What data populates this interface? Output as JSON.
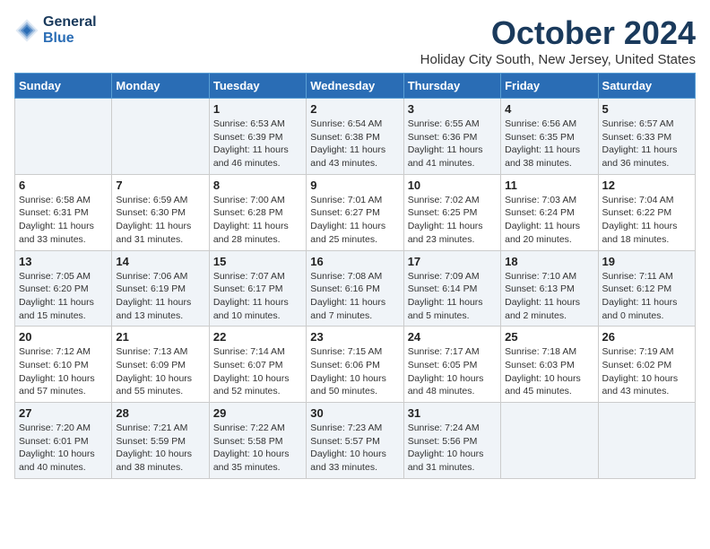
{
  "header": {
    "logo_line1": "General",
    "logo_line2": "Blue",
    "month_title": "October 2024",
    "location": "Holiday City South, New Jersey, United States"
  },
  "weekdays": [
    "Sunday",
    "Monday",
    "Tuesday",
    "Wednesday",
    "Thursday",
    "Friday",
    "Saturday"
  ],
  "weeks": [
    [
      {
        "day": "",
        "info": ""
      },
      {
        "day": "",
        "info": ""
      },
      {
        "day": "1",
        "info": "Sunrise: 6:53 AM\nSunset: 6:39 PM\nDaylight: 11 hours and 46 minutes."
      },
      {
        "day": "2",
        "info": "Sunrise: 6:54 AM\nSunset: 6:38 PM\nDaylight: 11 hours and 43 minutes."
      },
      {
        "day": "3",
        "info": "Sunrise: 6:55 AM\nSunset: 6:36 PM\nDaylight: 11 hours and 41 minutes."
      },
      {
        "day": "4",
        "info": "Sunrise: 6:56 AM\nSunset: 6:35 PM\nDaylight: 11 hours and 38 minutes."
      },
      {
        "day": "5",
        "info": "Sunrise: 6:57 AM\nSunset: 6:33 PM\nDaylight: 11 hours and 36 minutes."
      }
    ],
    [
      {
        "day": "6",
        "info": "Sunrise: 6:58 AM\nSunset: 6:31 PM\nDaylight: 11 hours and 33 minutes."
      },
      {
        "day": "7",
        "info": "Sunrise: 6:59 AM\nSunset: 6:30 PM\nDaylight: 11 hours and 31 minutes."
      },
      {
        "day": "8",
        "info": "Sunrise: 7:00 AM\nSunset: 6:28 PM\nDaylight: 11 hours and 28 minutes."
      },
      {
        "day": "9",
        "info": "Sunrise: 7:01 AM\nSunset: 6:27 PM\nDaylight: 11 hours and 25 minutes."
      },
      {
        "day": "10",
        "info": "Sunrise: 7:02 AM\nSunset: 6:25 PM\nDaylight: 11 hours and 23 minutes."
      },
      {
        "day": "11",
        "info": "Sunrise: 7:03 AM\nSunset: 6:24 PM\nDaylight: 11 hours and 20 minutes."
      },
      {
        "day": "12",
        "info": "Sunrise: 7:04 AM\nSunset: 6:22 PM\nDaylight: 11 hours and 18 minutes."
      }
    ],
    [
      {
        "day": "13",
        "info": "Sunrise: 7:05 AM\nSunset: 6:20 PM\nDaylight: 11 hours and 15 minutes."
      },
      {
        "day": "14",
        "info": "Sunrise: 7:06 AM\nSunset: 6:19 PM\nDaylight: 11 hours and 13 minutes."
      },
      {
        "day": "15",
        "info": "Sunrise: 7:07 AM\nSunset: 6:17 PM\nDaylight: 11 hours and 10 minutes."
      },
      {
        "day": "16",
        "info": "Sunrise: 7:08 AM\nSunset: 6:16 PM\nDaylight: 11 hours and 7 minutes."
      },
      {
        "day": "17",
        "info": "Sunrise: 7:09 AM\nSunset: 6:14 PM\nDaylight: 11 hours and 5 minutes."
      },
      {
        "day": "18",
        "info": "Sunrise: 7:10 AM\nSunset: 6:13 PM\nDaylight: 11 hours and 2 minutes."
      },
      {
        "day": "19",
        "info": "Sunrise: 7:11 AM\nSunset: 6:12 PM\nDaylight: 11 hours and 0 minutes."
      }
    ],
    [
      {
        "day": "20",
        "info": "Sunrise: 7:12 AM\nSunset: 6:10 PM\nDaylight: 10 hours and 57 minutes."
      },
      {
        "day": "21",
        "info": "Sunrise: 7:13 AM\nSunset: 6:09 PM\nDaylight: 10 hours and 55 minutes."
      },
      {
        "day": "22",
        "info": "Sunrise: 7:14 AM\nSunset: 6:07 PM\nDaylight: 10 hours and 52 minutes."
      },
      {
        "day": "23",
        "info": "Sunrise: 7:15 AM\nSunset: 6:06 PM\nDaylight: 10 hours and 50 minutes."
      },
      {
        "day": "24",
        "info": "Sunrise: 7:17 AM\nSunset: 6:05 PM\nDaylight: 10 hours and 48 minutes."
      },
      {
        "day": "25",
        "info": "Sunrise: 7:18 AM\nSunset: 6:03 PM\nDaylight: 10 hours and 45 minutes."
      },
      {
        "day": "26",
        "info": "Sunrise: 7:19 AM\nSunset: 6:02 PM\nDaylight: 10 hours and 43 minutes."
      }
    ],
    [
      {
        "day": "27",
        "info": "Sunrise: 7:20 AM\nSunset: 6:01 PM\nDaylight: 10 hours and 40 minutes."
      },
      {
        "day": "28",
        "info": "Sunrise: 7:21 AM\nSunset: 5:59 PM\nDaylight: 10 hours and 38 minutes."
      },
      {
        "day": "29",
        "info": "Sunrise: 7:22 AM\nSunset: 5:58 PM\nDaylight: 10 hours and 35 minutes."
      },
      {
        "day": "30",
        "info": "Sunrise: 7:23 AM\nSunset: 5:57 PM\nDaylight: 10 hours and 33 minutes."
      },
      {
        "day": "31",
        "info": "Sunrise: 7:24 AM\nSunset: 5:56 PM\nDaylight: 10 hours and 31 minutes."
      },
      {
        "day": "",
        "info": ""
      },
      {
        "day": "",
        "info": ""
      }
    ]
  ]
}
